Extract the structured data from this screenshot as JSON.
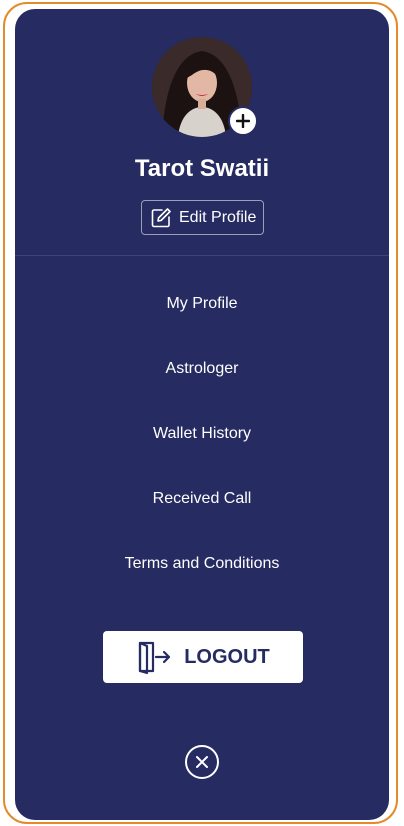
{
  "profile": {
    "name": "Tarot Swatii",
    "edit_label": "Edit Profile",
    "avatar_icon": "user-photo",
    "add_photo_icon": "plus-icon"
  },
  "menu": {
    "items": [
      {
        "label": "My Profile"
      },
      {
        "label": "Astrologer"
      },
      {
        "label": "Wallet History"
      },
      {
        "label": "Received Call"
      },
      {
        "label": "Terms and Conditions"
      }
    ]
  },
  "logout": {
    "label": "LOGOUT",
    "icon": "door-exit-icon"
  },
  "close": {
    "icon": "close-icon"
  },
  "colors": {
    "panel_background": "#262b62",
    "frame_border": "#e48a2a",
    "text": "#ffffff"
  }
}
